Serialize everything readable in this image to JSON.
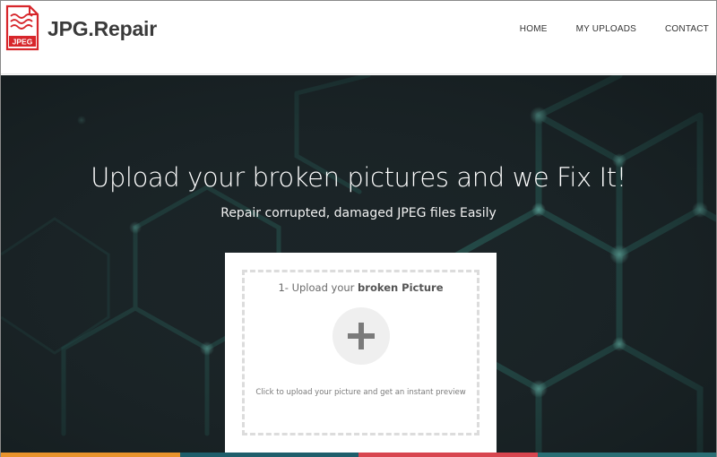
{
  "header": {
    "logo_text": "JPEG",
    "brand": "JPG.Repair",
    "nav": [
      {
        "label": "HOME"
      },
      {
        "label": "MY UPLOADS"
      },
      {
        "label": "CONTACT"
      }
    ]
  },
  "hero": {
    "title": "Upload your broken pictures and we Fix It!",
    "subtitle": "Repair corrupted, damaged JPEG files Easily"
  },
  "upload": {
    "title_prefix": "1- Upload your ",
    "title_bold": "broken Picture",
    "hint": "Click to upload your picture and get an instant preview",
    "icon": "plus-icon"
  },
  "colors": {
    "brand_red": "#d7262b",
    "hero_bg": "#1b2427",
    "network_teal": "#2f7a70",
    "strip": [
      "#e8932c",
      "#1f5e6b",
      "#d8454f",
      "#2a6e74"
    ]
  }
}
